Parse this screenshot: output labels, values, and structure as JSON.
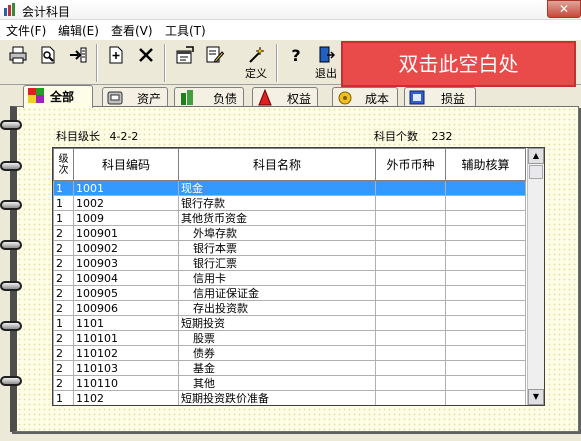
{
  "window": {
    "title": "会计科目",
    "close_label": "✕"
  },
  "menu": [
    {
      "label": "文件(F)"
    },
    {
      "label": "编辑(E)"
    },
    {
      "label": "查看(V)"
    },
    {
      "label": "工具(T)"
    }
  ],
  "toolbar": {
    "define_label": "定义",
    "exit_label": "退出",
    "callout_text": "双击此空白处"
  },
  "tabs": [
    {
      "label": "全部",
      "active": true
    },
    {
      "label": "资产"
    },
    {
      "label": "负债"
    },
    {
      "label": "权益"
    },
    {
      "label": "成本"
    },
    {
      "label": "损益"
    }
  ],
  "info": {
    "level_label": "科目级长",
    "level_value": "4-2-2",
    "count_label": "科目个数",
    "count_value": "232"
  },
  "table": {
    "columns": [
      "级次",
      "科目编码",
      "科目名称",
      "外币币种",
      "辅助核算"
    ],
    "rows": [
      {
        "level": "1",
        "code": "1001",
        "name": "现金",
        "indent": false,
        "selected": true
      },
      {
        "level": "1",
        "code": "1002",
        "name": "银行存款",
        "indent": false
      },
      {
        "level": "1",
        "code": "1009",
        "name": "其他货币资金",
        "indent": false
      },
      {
        "level": "2",
        "code": "100901",
        "name": "外埠存款",
        "indent": true
      },
      {
        "level": "2",
        "code": "100902",
        "name": "银行本票",
        "indent": true
      },
      {
        "level": "2",
        "code": "100903",
        "name": "银行汇票",
        "indent": true
      },
      {
        "level": "2",
        "code": "100904",
        "name": "信用卡",
        "indent": true
      },
      {
        "level": "2",
        "code": "100905",
        "name": "信用证保证金",
        "indent": true
      },
      {
        "level": "2",
        "code": "100906",
        "name": "存出投资款",
        "indent": true
      },
      {
        "level": "1",
        "code": "1101",
        "name": "短期投资",
        "indent": false
      },
      {
        "level": "2",
        "code": "110101",
        "name": "股票",
        "indent": true
      },
      {
        "level": "2",
        "code": "110102",
        "name": "债券",
        "indent": true
      },
      {
        "level": "2",
        "code": "110103",
        "name": "基金",
        "indent": true
      },
      {
        "level": "2",
        "code": "110110",
        "name": "其他",
        "indent": true
      },
      {
        "level": "1",
        "code": "1102",
        "name": "短期投资跌价准备",
        "indent": false
      }
    ]
  },
  "colors": {
    "selection": "#3399ff",
    "callout": "#e94b4b"
  }
}
